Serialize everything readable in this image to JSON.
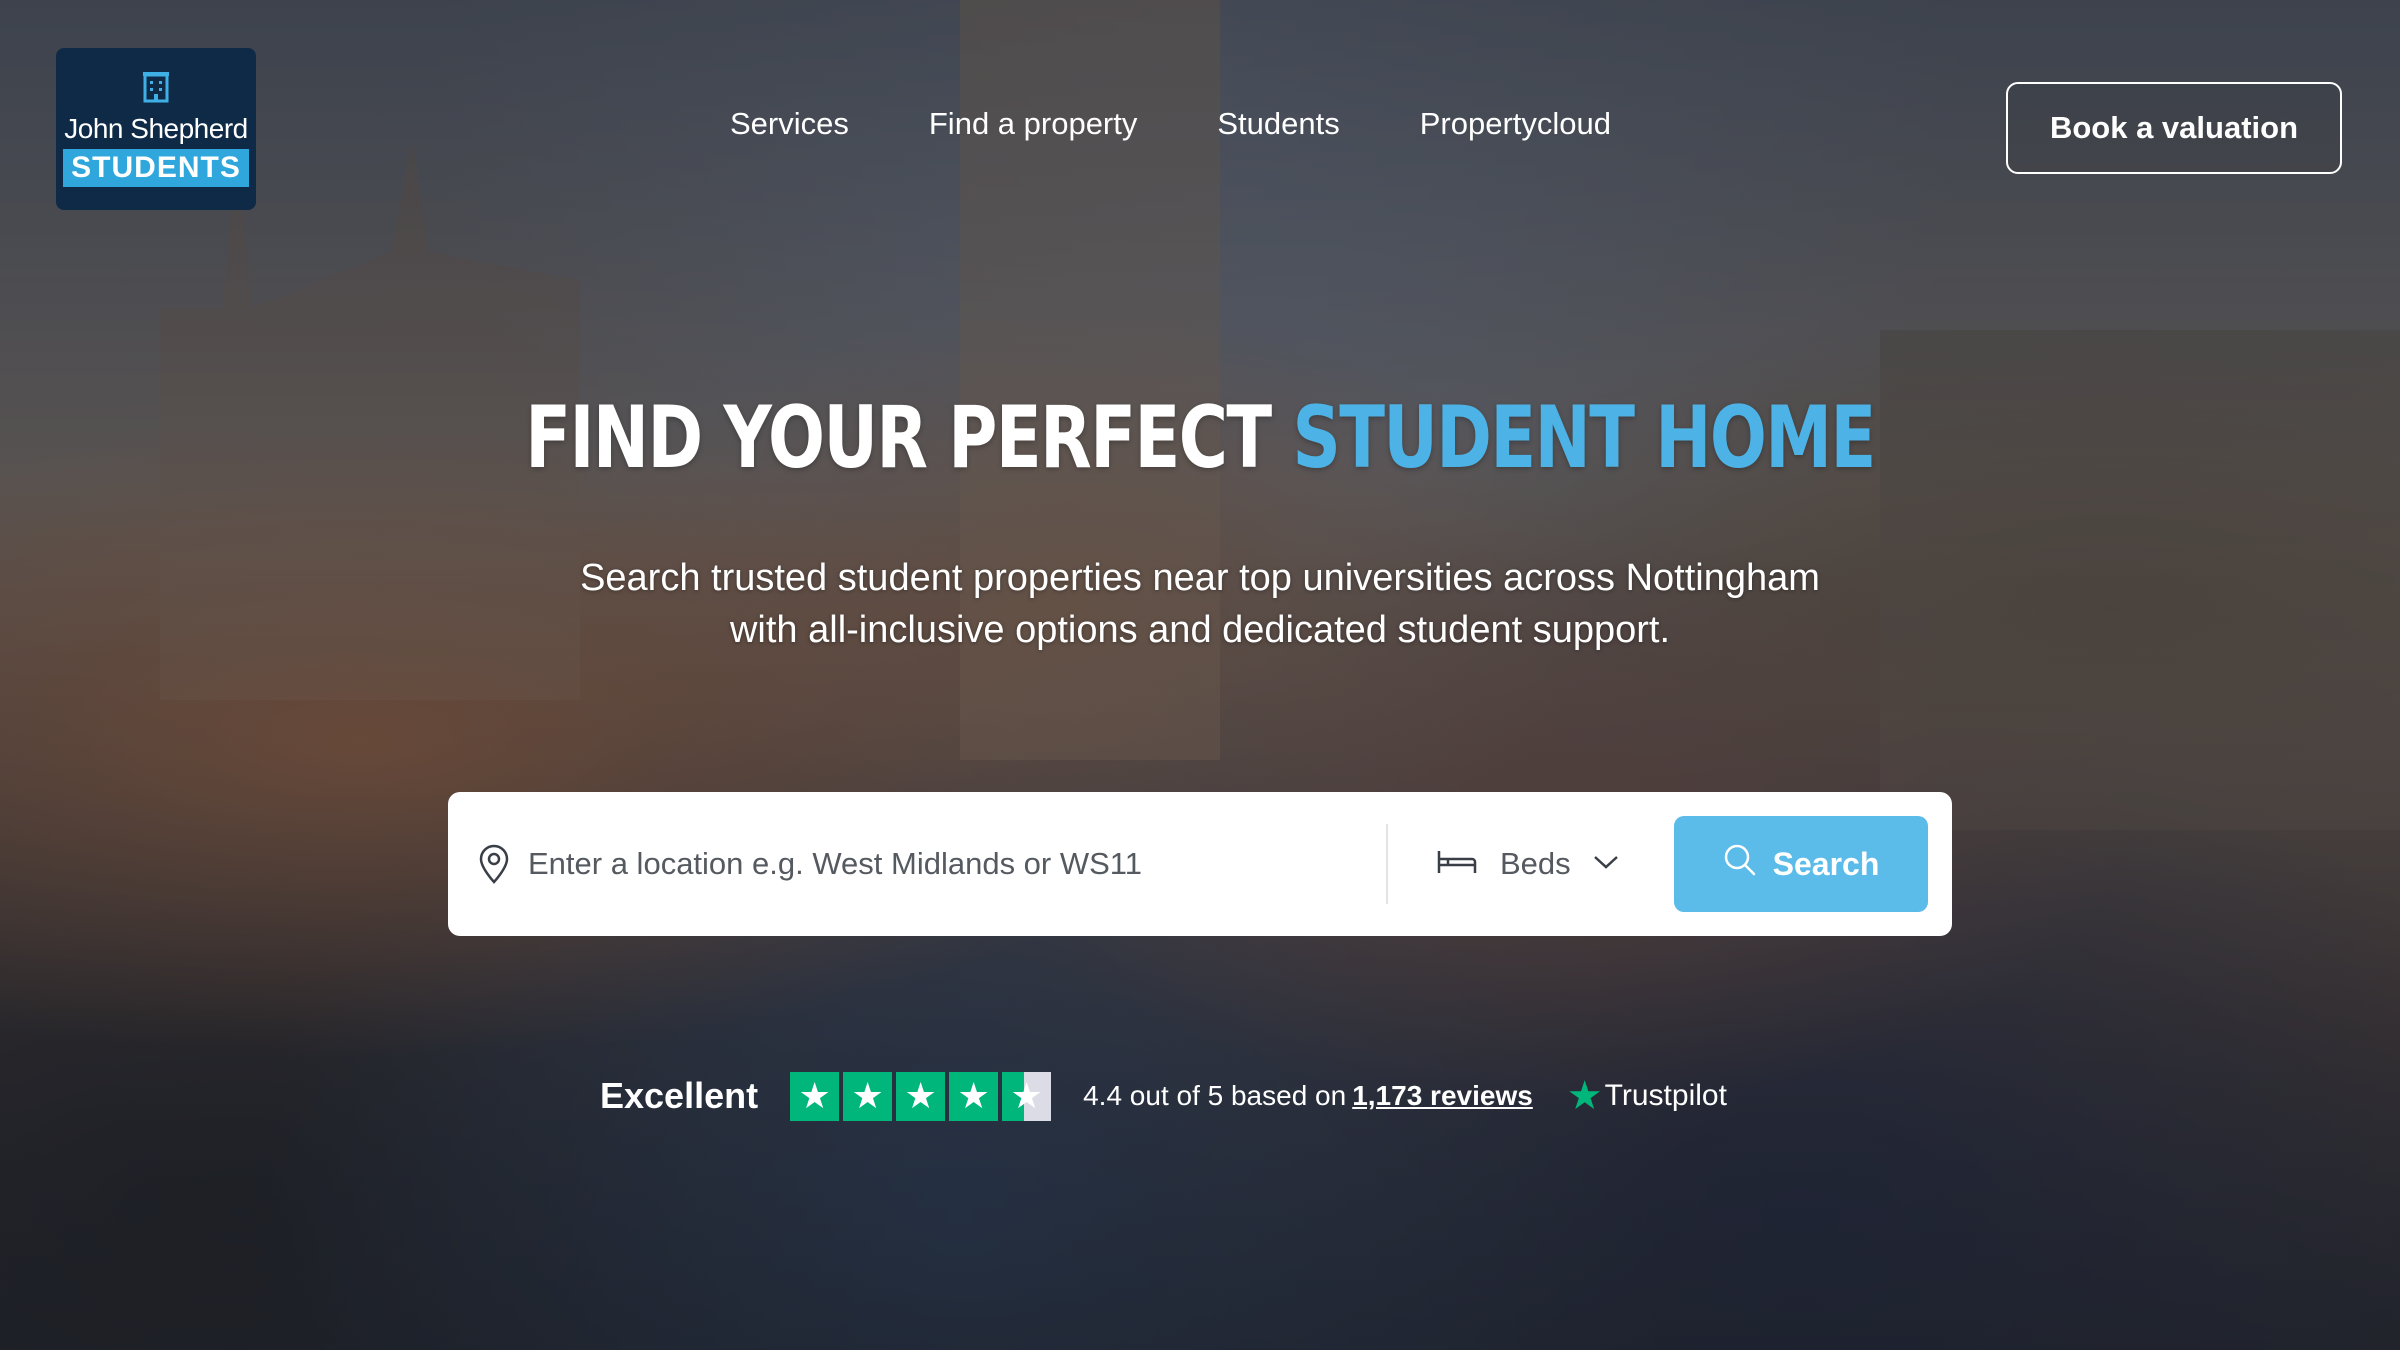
{
  "brand": {
    "name": "John Shepherd",
    "badge": "STUDENTS",
    "icon": "building-icon"
  },
  "nav": {
    "items": [
      {
        "label": "Services"
      },
      {
        "label": "Find a property"
      },
      {
        "label": "Students"
      },
      {
        "label": "Propertycloud"
      }
    ],
    "cta_label": "Book a valuation"
  },
  "hero": {
    "headline_white": "FIND YOUR PERFECT",
    "headline_blue": "STUDENT HOME",
    "subtitle_line1": "Search trusted student properties near top universities across Nottingham",
    "subtitle_line2": "with all-inclusive options and dedicated student support."
  },
  "search": {
    "location_placeholder": "Enter a location e.g. West Midlands or WS11",
    "location_value": "",
    "beds_label": "Beds",
    "button_label": "Search"
  },
  "trustpilot": {
    "rating_word": "Excellent",
    "stars": 4.4,
    "summary_text": "4.4 out of 5 based on",
    "reviews_link": "1,173 reviews",
    "brand": "Trustpilot"
  },
  "colors": {
    "accent": "#4db3e6",
    "button": "#5bbbe9",
    "logo_bg": "#0f2a47",
    "trustpilot_green": "#00b67a"
  }
}
